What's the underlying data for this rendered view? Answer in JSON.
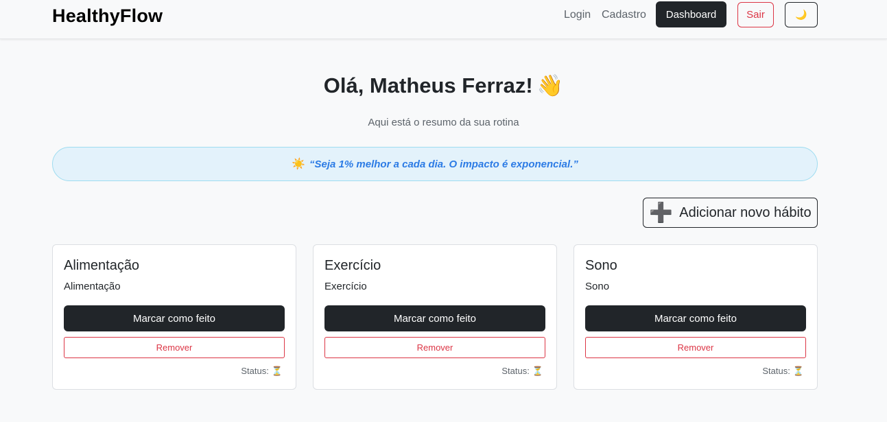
{
  "navbar": {
    "brand": "HealthyFlow",
    "login_label": "Login",
    "cadastro_label": "Cadastro",
    "dashboard_label": "Dashboard",
    "sair_label": "Sair",
    "theme_icon": "🌙"
  },
  "main": {
    "greeting": "Olá, Matheus Ferraz!",
    "greeting_emoji": "👋",
    "subtitle": "Aqui está o resumo da sua rotina",
    "quote_icon": "☀️",
    "quote": "“Seja 1% melhor a cada dia. O impacto é exponencial.”",
    "add_habit_icon": "➕",
    "add_habit_label": "Adicionar novo hábito"
  },
  "habits": [
    {
      "title": "Alimentação",
      "description": "Alimentação",
      "done_label": "Marcar como feito",
      "remove_label": "Remover",
      "status_label": "Status:",
      "status_icon": "⏳"
    },
    {
      "title": "Exercício",
      "description": "Exercício",
      "done_label": "Marcar como feito",
      "remove_label": "Remover",
      "status_label": "Status:",
      "status_icon": "⏳"
    },
    {
      "title": "Sono",
      "description": "Sono",
      "done_label": "Marcar como feito",
      "remove_label": "Remover",
      "status_label": "Status:",
      "status_icon": "⏳"
    }
  ],
  "colors": {
    "primary_dark": "#212529",
    "danger": "#dc3545",
    "quote_bg": "#e3f2fb",
    "quote_text": "#2c7be5"
  }
}
